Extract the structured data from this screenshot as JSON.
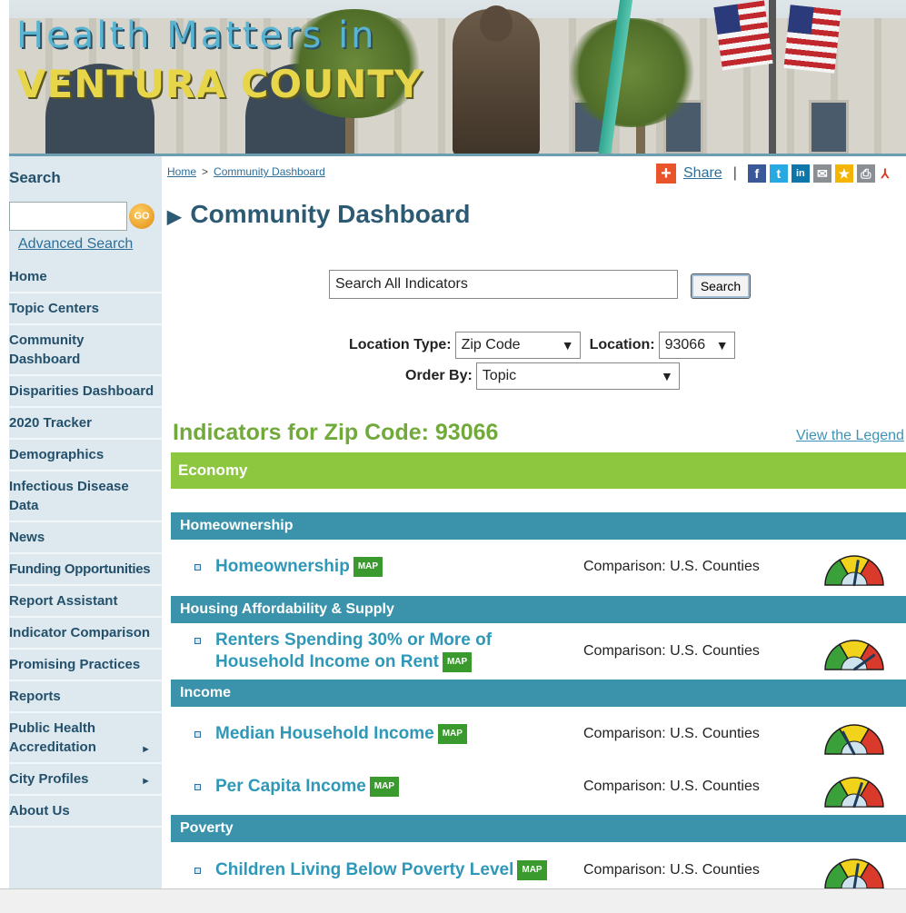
{
  "banner": {
    "title_line1": "Health Matters in",
    "title_line2": "VENTURA COUNTY"
  },
  "sidebar": {
    "search_label": "Search",
    "search_placeholder": "",
    "go_label": "GO",
    "advanced_search": "Advanced Search",
    "items": [
      {
        "label": "Home",
        "arrow": ""
      },
      {
        "label": "Topic Centers",
        "arrow": ""
      },
      {
        "label": "Community Dashboard",
        "arrow": ""
      },
      {
        "label": "Disparities Dashboard",
        "arrow": ""
      },
      {
        "label": "2020 Tracker",
        "arrow": ""
      },
      {
        "label": "Demographics",
        "arrow": ""
      },
      {
        "label": "Infectious Disease Data",
        "arrow": ""
      },
      {
        "label": "News",
        "arrow": ""
      },
      {
        "label": "Funding Opportunities",
        "arrow": ""
      },
      {
        "label": "Report Assistant",
        "arrow": ""
      },
      {
        "label": "Indicator Comparison",
        "arrow": ""
      },
      {
        "label": "Promising Practices",
        "arrow": ""
      },
      {
        "label": "Reports",
        "arrow": ""
      },
      {
        "label": "Public Health Accreditation",
        "arrow": "►"
      },
      {
        "label": "City Profiles",
        "arrow": "►"
      },
      {
        "label": "About Us",
        "arrow": ""
      }
    ]
  },
  "breadcrumb": {
    "home": "Home",
    "separator": ">",
    "current": "Community Dashboard"
  },
  "share": {
    "label": "Share",
    "divider": "|",
    "icons": [
      {
        "name": "facebook-icon",
        "glyph": "f",
        "color": "#3b5998"
      },
      {
        "name": "twitter-icon",
        "glyph": "t",
        "color": "#29a9e1"
      },
      {
        "name": "linkedin-icon",
        "glyph": "in",
        "color": "#0e76a8"
      },
      {
        "name": "email-icon",
        "glyph": "✉",
        "color": "#8a8f94"
      },
      {
        "name": "favorite-star-icon",
        "glyph": "★",
        "color": "#f4b400"
      },
      {
        "name": "print-icon",
        "glyph": "⎙",
        "color": "#8a8f94"
      },
      {
        "name": "pdf-icon",
        "glyph": "⅄",
        "color": "#d9381e"
      }
    ]
  },
  "page": {
    "title": "Community Dashboard",
    "search_all_value": "Search All Indicators",
    "search_button": "Search",
    "location_type_label": "Location Type:",
    "location_type_value": "Zip Code",
    "location_label": "Location:",
    "location_value": "93066",
    "order_by_label": "Order By:",
    "order_by_value": "Topic",
    "indicators_title": "Indicators for Zip Code: 93066",
    "legend_link": "View the Legend"
  },
  "sections": {
    "economy": "Economy",
    "homeownership": "Homeownership",
    "housing": "Housing Affordability & Supply",
    "income": "Income",
    "poverty": "Poverty"
  },
  "indicators": [
    {
      "name": "Homeownership",
      "map": "MAP",
      "comparison": "Comparison: U.S. Counties"
    },
    {
      "name": "Renters Spending 30% or More of Household Income on Rent",
      "map": "MAP",
      "comparison": "Comparison: U.S. Counties"
    },
    {
      "name": "Median Household Income",
      "map": "MAP",
      "comparison": "Comparison: U.S. Counties"
    },
    {
      "name": "Per Capita Income",
      "map": "MAP",
      "comparison": "Comparison: U.S. Counties"
    },
    {
      "name": "Children Living Below Poverty Level",
      "map": "MAP",
      "comparison": "Comparison: U.S. Counties"
    }
  ],
  "gauge_needles": [
    0.55,
    0.8,
    0.35,
    0.6,
    0.55
  ],
  "colors": {
    "economy_bar": "#8dc63f",
    "subhead_bar": "#3a93ab",
    "indicator_link": "#2f98b8",
    "map_badge": "#3a9a2d",
    "indicators_title": "#71a93b"
  }
}
